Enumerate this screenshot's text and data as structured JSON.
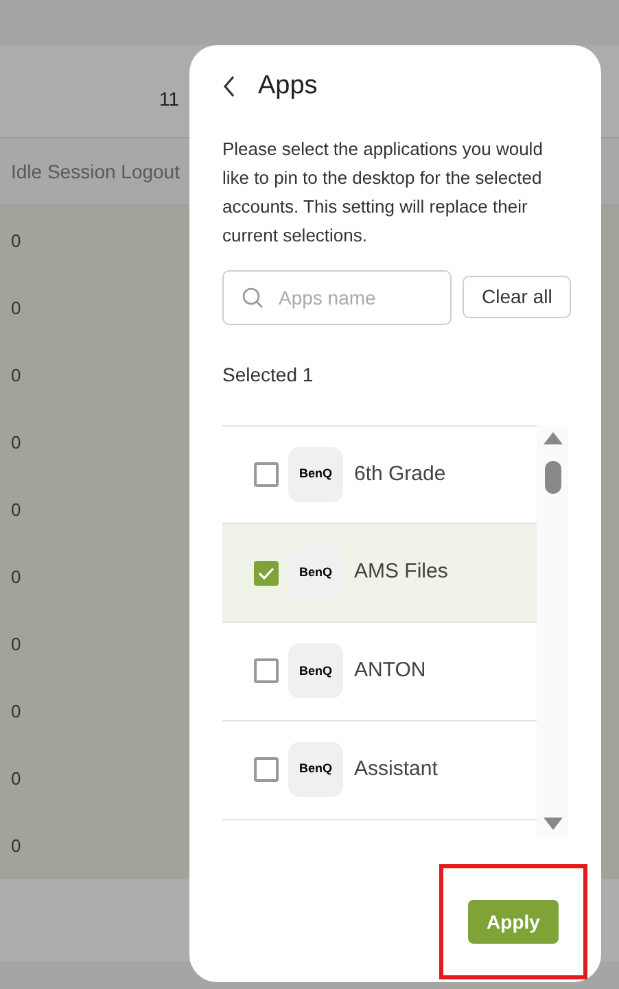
{
  "background": {
    "header_text": "11",
    "column_header": "Idle Session Logout",
    "rows": [
      "0",
      "0",
      "0",
      "0",
      "0",
      "0",
      "0",
      "0",
      "0",
      "0"
    ]
  },
  "panel": {
    "title": "Apps",
    "description": "Please select the applications you would like to pin to the desktop for the selected accounts. This setting will replace their current selections.",
    "search": {
      "placeholder": "Apps name"
    },
    "clear_button": "Clear all",
    "selected_count": "Selected 1",
    "apps": [
      {
        "logo": "BenQ",
        "name": "6th Grade",
        "checked": false
      },
      {
        "logo": "BenQ",
        "name": "AMS Files",
        "checked": true
      },
      {
        "logo": "BenQ",
        "name": "ANTON",
        "checked": false
      },
      {
        "logo": "BenQ",
        "name": "Assistant",
        "checked": false
      }
    ],
    "apply_button": {
      "label": "Apply",
      "highlighted": true
    }
  }
}
